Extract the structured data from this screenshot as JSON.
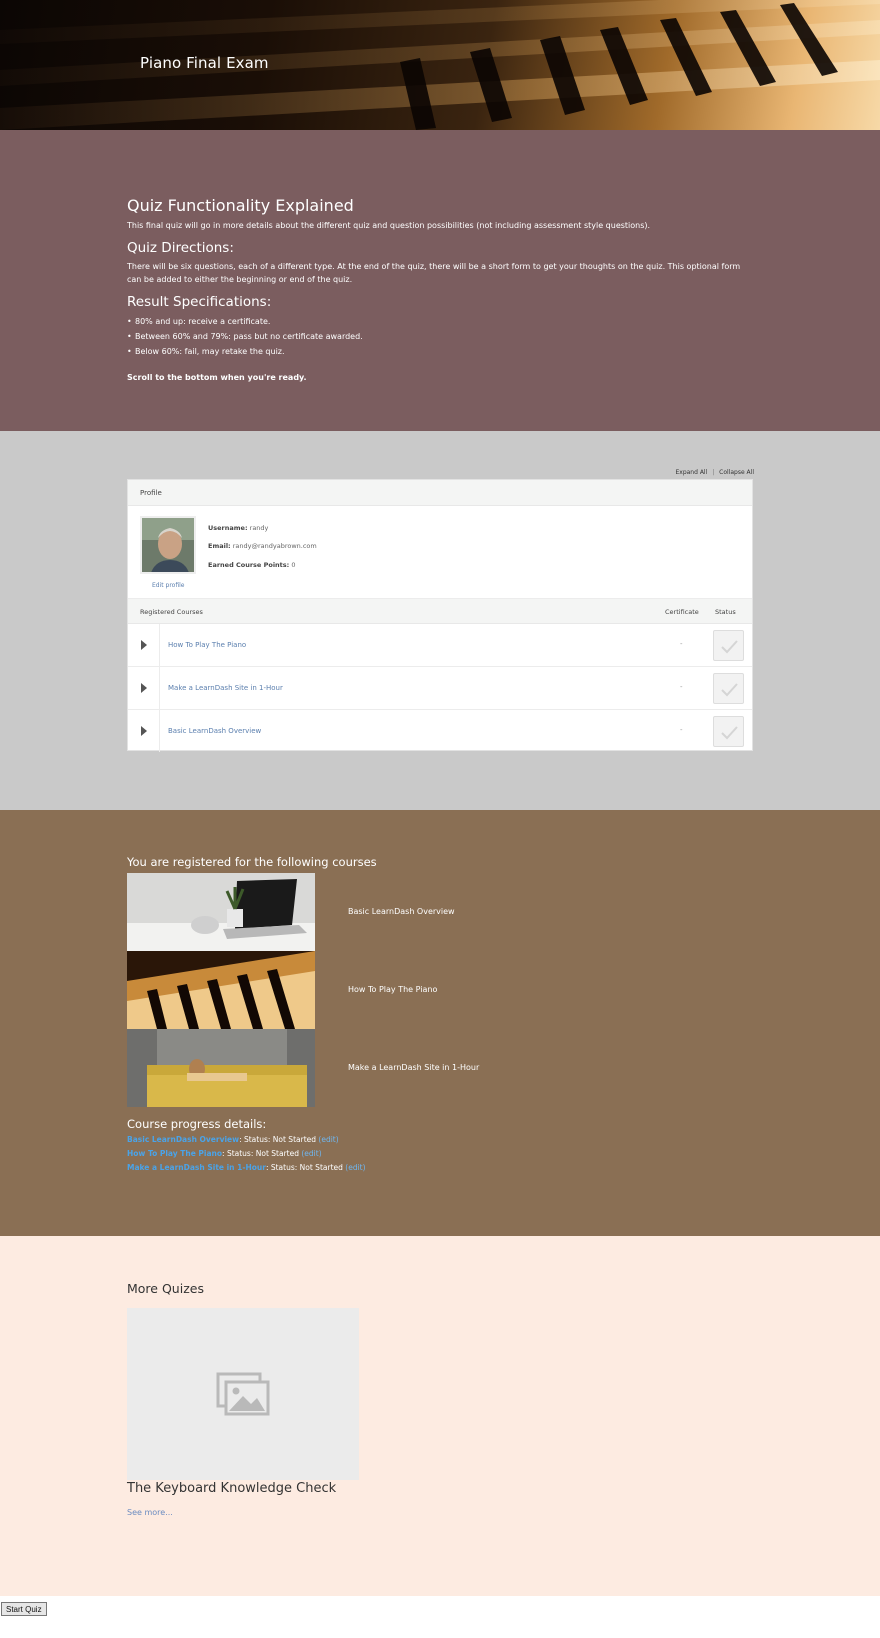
{
  "hero": {
    "title": "Piano Final Exam"
  },
  "intro": {
    "heading": "Quiz Functionality Explained",
    "description": "This final quiz will go in more details about the different quiz and question possibilities (not including assessment style questions).",
    "directions_heading": "Quiz Directions:",
    "directions_text": "There will be six questions, each of a different type. At the end of the quiz, there will be a short form to get your thoughts on the quiz. This optional form can be added to either the beginning or end of the quiz.",
    "results_heading": "Result Specifications:",
    "results": [
      "80% and up: receive a certificate.",
      "Between 60% and 79%: pass but no certificate awarded.",
      "Below 60%: fail, may retake the quiz."
    ],
    "ready_text": "Scroll to the bottom when you're ready."
  },
  "profile": {
    "expand_all": "Expand All",
    "separator": "|",
    "collapse_all": "Collapse All",
    "header": "Profile",
    "username_label": "Username:",
    "username": "randy",
    "email_label": "Email:",
    "email": "randy@randyabrown.com",
    "points_label": "Earned Course Points:",
    "points": "0",
    "edit_profile": "Edit profile",
    "registered_header": "Registered Courses",
    "certificate_header": "Certificate",
    "status_header": "Status",
    "courses": [
      {
        "name": "How To Play The Piano",
        "certificate": "-"
      },
      {
        "name": "Make a LearnDash Site in 1-Hour",
        "certificate": "-"
      },
      {
        "name": "Basic LearnDash Overview",
        "certificate": "-"
      }
    ]
  },
  "registered": {
    "heading": "You are registered for the following courses",
    "courses": [
      {
        "title": "Basic LearnDash Overview"
      },
      {
        "title": "How To Play The Piano"
      },
      {
        "title": "Make a LearnDash Site in 1-Hour"
      }
    ],
    "progress_heading": "Course progress details:",
    "progress": [
      {
        "course": "Basic LearnDash Overview",
        "status": ": Status: Not Started",
        "edit": "(edit)"
      },
      {
        "course": "How To Play The Piano",
        "status": ": Status: Not Started",
        "edit": "(edit)"
      },
      {
        "course": "Make a LearnDash Site in 1-Hour",
        "status": ": Status: Not Started",
        "edit": "(edit)"
      }
    ]
  },
  "more_quizes": {
    "heading": "More Quizes",
    "quiz_title": "The Keyboard Knowledge Check",
    "see_more": "See more..."
  },
  "start_quiz_label": "Start Quiz",
  "colors": {
    "section_intro": "#7b5d5f",
    "section_profile": "#c9c9c9",
    "section_registered": "#8a6f54",
    "section_more": "#fdebe1",
    "link": "#5b7fae",
    "progress_link": "#4aa3e8"
  }
}
